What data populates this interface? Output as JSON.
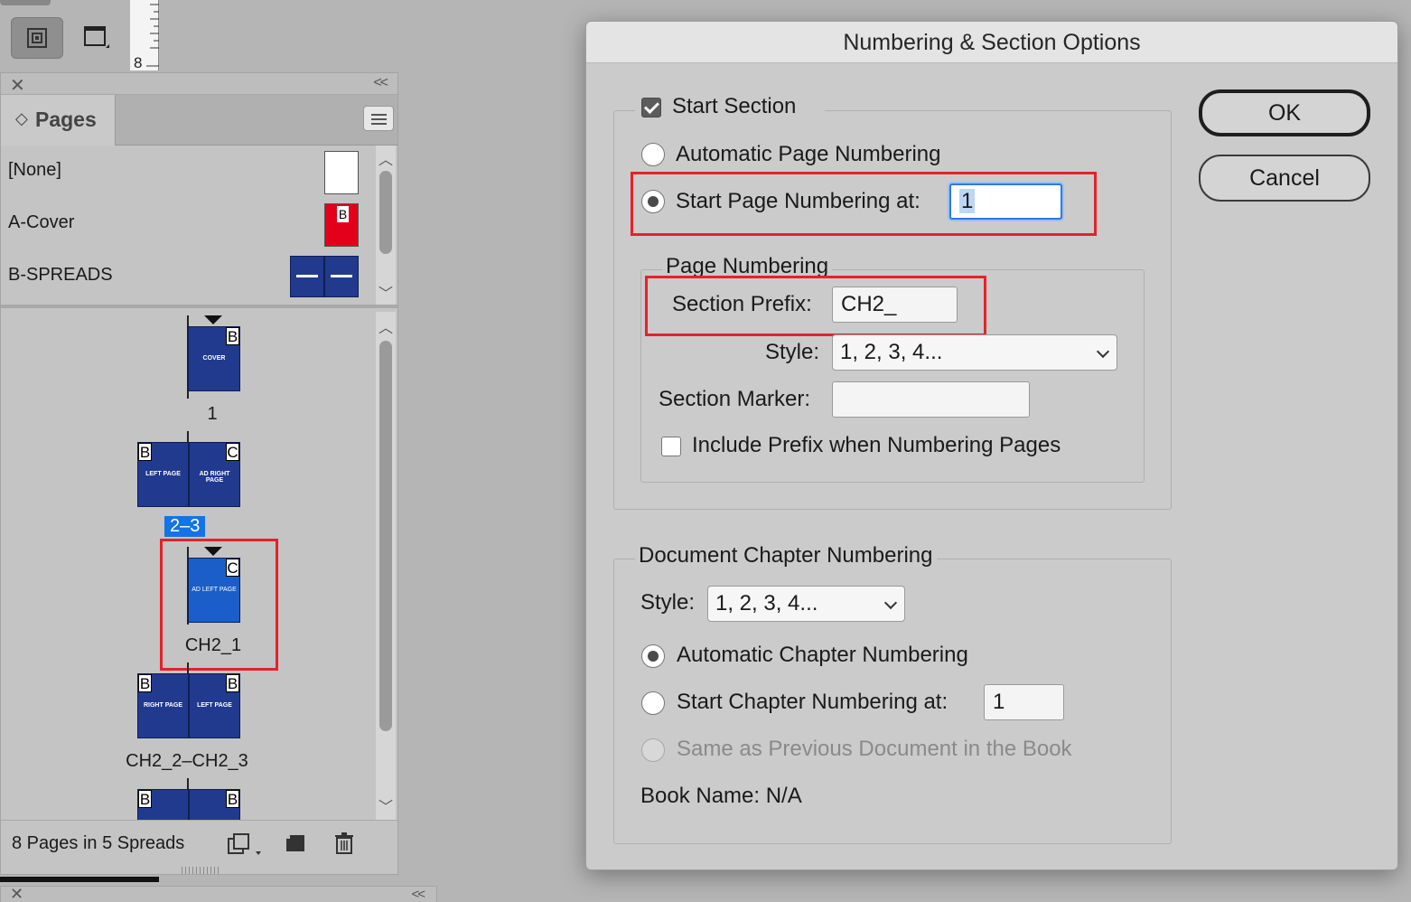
{
  "toolbar": {
    "ruler_mark": "8"
  },
  "pages_panel": {
    "close_glyph": "✕",
    "collapse_glyph": "<<",
    "tab_label": "Pages",
    "tab_chevron": "◇",
    "masters": [
      {
        "label": "[None]"
      },
      {
        "label": "A-Cover",
        "letter": "B"
      },
      {
        "label": "B-SPREADS"
      }
    ],
    "thumbs": {
      "cover": {
        "letter": "B",
        "text": "COVER",
        "number": "1"
      },
      "spread1": {
        "left_letter": "B",
        "right_letter": "C",
        "left_text": "LEFT PAGE",
        "right_text": "AD RIGHT PAGE",
        "number": "2–3"
      },
      "single": {
        "letter": "C",
        "text": "AD LEFT PAGE",
        "number": "CH2_1"
      },
      "spread2": {
        "left_letter": "B",
        "right_letter": "B",
        "left_text": "RIGHT PAGE",
        "right_text": "LEFT PAGE",
        "number": "CH2_2–CH2_3"
      },
      "spread3": {
        "left_letter": "B",
        "right_letter": "B"
      }
    },
    "footer_text": "8 Pages in 5 Spreads",
    "icons": [
      "edit-page-size-icon",
      "new-page-icon",
      "trash-icon"
    ]
  },
  "dialog": {
    "title": "Numbering & Section Options",
    "start_section": {
      "label": "Start Section",
      "checked": true
    },
    "auto_page_numbering": {
      "label": "Automatic Page Numbering",
      "selected": false
    },
    "start_page_numbering": {
      "label": "Start Page Numbering at:",
      "value": "1",
      "selected": true
    },
    "page_numbering_group": "Page Numbering",
    "section_prefix": {
      "label": "Section Prefix:",
      "value": "CH2_"
    },
    "style": {
      "label": "Style:",
      "value": "1, 2, 3, 4..."
    },
    "section_marker": {
      "label": "Section Marker:",
      "value": ""
    },
    "include_prefix": {
      "label": "Include Prefix when Numbering Pages",
      "checked": false
    },
    "chapter_group": "Document Chapter Numbering",
    "chapter_style": {
      "label": "Style:",
      "value": "1, 2, 3, 4..."
    },
    "auto_chapter": {
      "label": "Automatic Chapter Numbering",
      "selected": true
    },
    "start_chapter": {
      "label": "Start Chapter Numbering at:",
      "value": "1",
      "selected": false
    },
    "same_as_previous": {
      "label": "Same as Previous Document in the Book",
      "enabled": false
    },
    "book_name": "Book Name: N/A",
    "ok_label": "OK",
    "cancel_label": "Cancel"
  },
  "colors": {
    "highlight_red": "#e8202a",
    "focus_blue": "#2d7ae0",
    "page_blue": "#213a8e",
    "selected_page_blue": "#1b5ec9",
    "master_red": "#e3001b"
  }
}
